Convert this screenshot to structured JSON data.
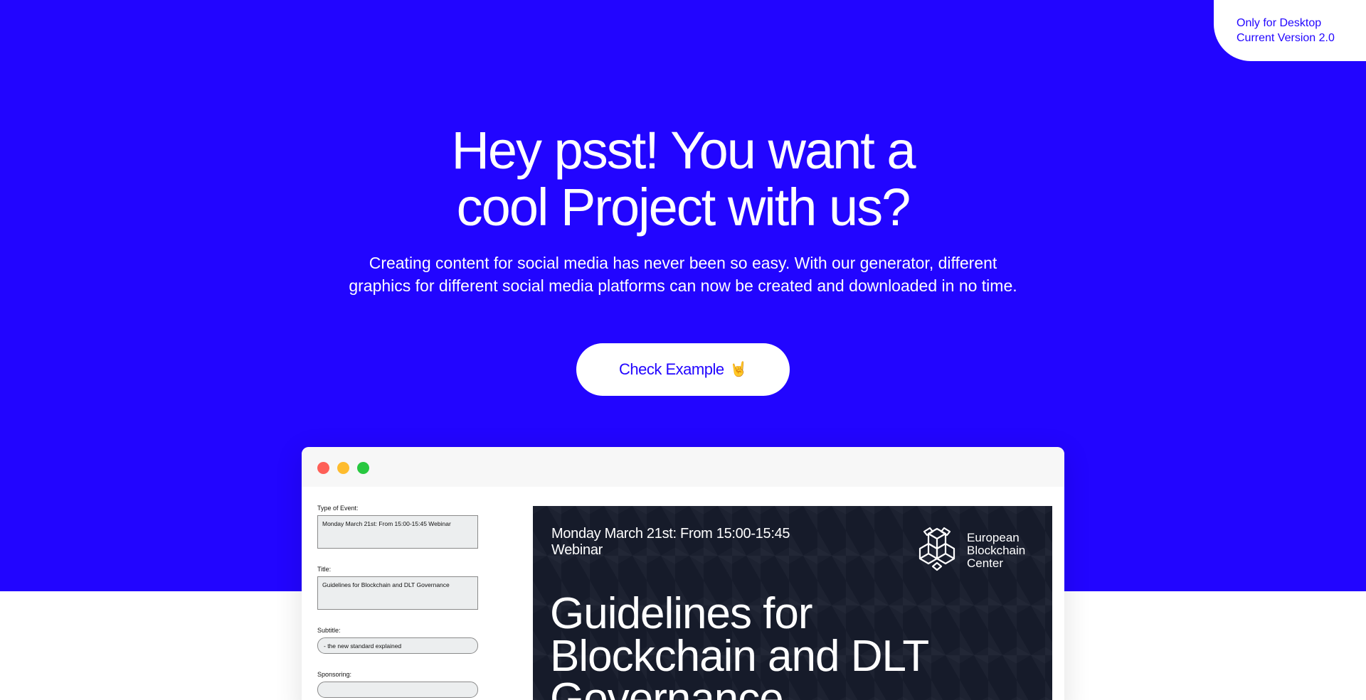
{
  "badge": {
    "line1": "Only for Desktop",
    "line2": "Current Version 2.0"
  },
  "hero": {
    "headline_line1": "Hey psst! You want a",
    "headline_line2": "cool Project with us?",
    "lead_line1": "Creating content for social media has never been so easy. With our generator, different",
    "lead_line2": "graphics for different social media platforms can now be created and downloaded in no time.",
    "cta_label": "Check Example",
    "cta_icon": "rock-hand-icon"
  },
  "editor": {
    "fields": [
      {
        "label": "Type of Event:",
        "value": "Monday March 21st: From 15:00-15:45 Webinar"
      },
      {
        "label": "Title:",
        "value": "Guidelines for Blockchain and DLT Governance"
      },
      {
        "label": "Subtitle:",
        "value": "- the new standard explained"
      },
      {
        "label": "Sponsoring:",
        "value": ""
      }
    ]
  },
  "preview": {
    "event_line1": "Monday March  21st: From 15:00-15:45",
    "event_line2": "Webinar",
    "logo_line1": "European",
    "logo_line2": "Blockchain",
    "logo_line3": "Center",
    "title_line1": "Guidelines for",
    "title_line2": "Blockchain and DLT",
    "title_line3": "Governance"
  },
  "colors": {
    "brand_blue": "#2205ff",
    "preview_bg": "#161b2a"
  }
}
